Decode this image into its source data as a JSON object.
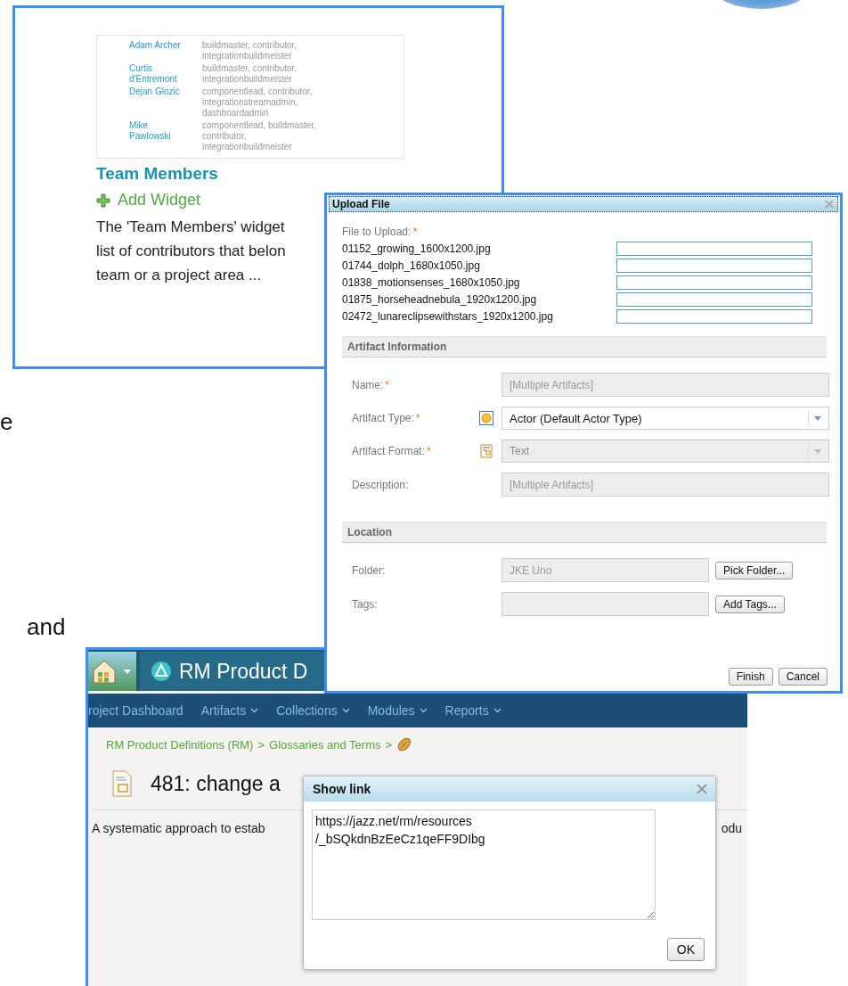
{
  "team_panel": {
    "members": [
      {
        "name": "Adam Archer",
        "roles": "buildmaster, contributor, integrationbuildmeister"
      },
      {
        "name": "Curtis d'Entremont",
        "roles": "buildmaster, contributor, integrationbuildmeister"
      },
      {
        "name": "Dejan Glozic",
        "roles": "componentlead, contributor, integrationstreamadmin, dashboardadmin"
      },
      {
        "name": "Mike Pawlowski",
        "roles": "componentlead, buildmaster, contributor, integrationbuildmeister"
      }
    ],
    "title": "Team Members",
    "add_widget": "Add Widget",
    "description_lines": [
      "The 'Team Members' widget",
      "list of contributors that belon",
      "team or a project area ..."
    ]
  },
  "stray_texts": [
    "e",
    "and"
  ],
  "upload_dialog": {
    "title": "Upload File",
    "file_label": "File to Upload:",
    "file_required_mark": "*",
    "files": [
      "01152_growing_1600x1200.jpg",
      "01744_dolph_1680x1050.jpg",
      "01838_motionsenses_1680x1050.jpg",
      "01875_horseheadnebula_1920x1200.jpg",
      "02472_lunareclipsewithstars_1920x1200.jpg"
    ],
    "sections": [
      {
        "title": "Artifact Information",
        "fields": [
          {
            "kind": "text",
            "label": "Name:",
            "required_mark": "*",
            "value": "[Multiple Artifacts]",
            "disabled": true
          },
          {
            "kind": "select",
            "label": "Artifact Type:",
            "required_mark": "*",
            "value": "Actor (Default Actor Type)",
            "disabled": false
          },
          {
            "kind": "select",
            "label": "Artifact Format:",
            "required_mark": "*",
            "value": "Text",
            "disabled": true
          },
          {
            "kind": "text",
            "label": "Description:",
            "value": "[Multiple Artifacts]",
            "disabled": true
          }
        ]
      },
      {
        "title": "Location",
        "fields": [
          {
            "kind": "button",
            "label": "Folder:",
            "value": "JKE Uno",
            "disabled": true,
            "button": "Pick Folder..."
          },
          {
            "kind": "button",
            "label": "Tags:",
            "disabled": true,
            "button": "Add Tags..."
          }
        ]
      }
    ],
    "buttons": [
      "Finish",
      "Cancel"
    ]
  },
  "rm_window": {
    "title": "RM Product D",
    "nav": [
      {
        "label": "roject Dashboard",
        "menu": false
      },
      {
        "label": "Artifacts",
        "menu": true
      },
      {
        "label": "Collections",
        "menu": true
      },
      {
        "label": "Modules",
        "menu": true
      },
      {
        "label": "Reports",
        "menu": true
      }
    ],
    "breadcrumb": [
      {
        "label": "RM Product Definitions (RM)",
        "separator": ">"
      },
      {
        "label": "Glossaries and Terms",
        "separator": ">"
      }
    ],
    "heading": "481: change a",
    "description": "A systematic approach to estab",
    "description_tail": "odu",
    "link_dialog": {
      "title": "Show link",
      "link": "https://jazz.net/rm/resources\n/_bSQkdnBzEeCz1qeFF9DIbg",
      "button": "OK"
    }
  }
}
